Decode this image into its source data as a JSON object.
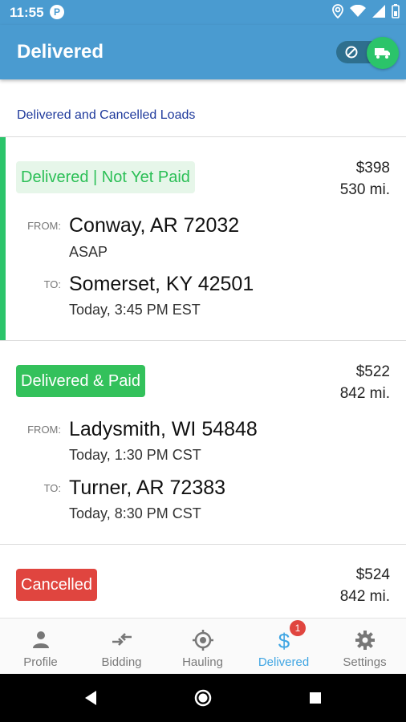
{
  "status_bar": {
    "time": "11:55",
    "notification_glyph": "P"
  },
  "app_bar": {
    "title": "Delivered"
  },
  "section": {
    "label": "Delivered and Cancelled Loads"
  },
  "colors": {
    "primary": "#4a9bd0",
    "green": "#2bc46a",
    "red": "#e0453f",
    "active_tab": "#3fa5e3",
    "section_label": "#1f3a9c"
  },
  "loads": [
    {
      "status": "Delivered | Not Yet Paid",
      "price": "$398",
      "miles": "530 mi.",
      "from_label": "FROM:",
      "from_city": "Conway, AR 72032",
      "from_time": "ASAP",
      "to_label": "TO:",
      "to_city": "Somerset, KY 42501",
      "to_time": "Today, 3:45 PM EST"
    },
    {
      "status": "Delivered & Paid",
      "price": "$522",
      "miles": "842 mi.",
      "from_label": "FROM:",
      "from_city": "Ladysmith, WI 54848",
      "from_time": "Today, 1:30 PM CST",
      "to_label": "TO:",
      "to_city": "Turner, AR 72383",
      "to_time": "Today, 8:30 PM CST"
    },
    {
      "status": "Cancelled",
      "price": "$524",
      "miles": "842 mi."
    }
  ],
  "bottom_nav": {
    "items": [
      {
        "label": "Profile",
        "icon": "person-icon"
      },
      {
        "label": "Bidding",
        "icon": "swap-arrows-icon"
      },
      {
        "label": "Hauling",
        "icon": "crosshair-icon"
      },
      {
        "label": "Delivered",
        "icon": "dollar-icon"
      },
      {
        "label": "Settings",
        "icon": "gear-icon"
      }
    ],
    "active": "Delivered",
    "delivered_badge": "1"
  }
}
